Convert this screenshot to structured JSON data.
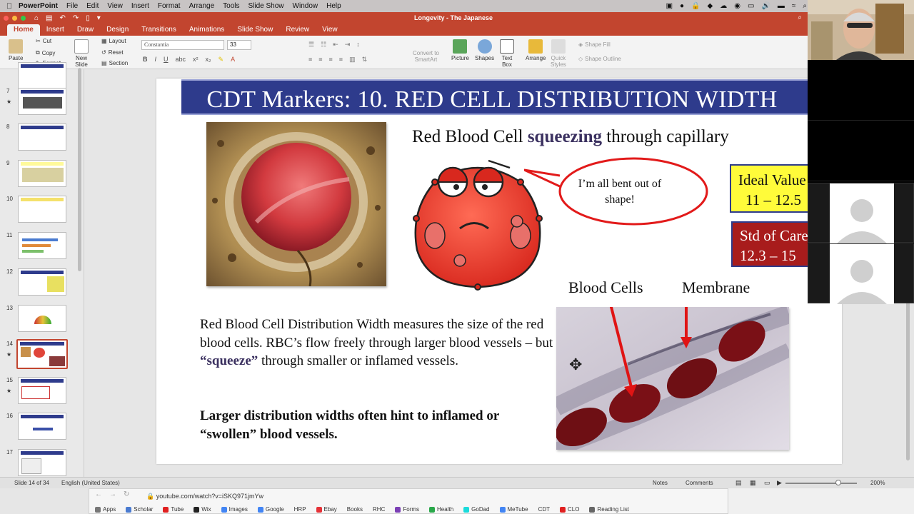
{
  "menubar": {
    "app": "PowerPoint",
    "items": [
      "File",
      "Edit",
      "View",
      "Insert",
      "Format",
      "Arrange",
      "Tools",
      "Slide Show",
      "Window",
      "Help"
    ]
  },
  "titlebar": {
    "doc_title": "Longevity - The Japanese"
  },
  "ribbon_tabs": [
    "Home",
    "Insert",
    "Draw",
    "Design",
    "Transitions",
    "Animations",
    "Slide Show",
    "Review",
    "View"
  ],
  "ribbon": {
    "paste": "Paste",
    "cut": "Cut",
    "copy": "Copy",
    "format": "Format",
    "new_slide": "New\nSlide",
    "layout": "Layout",
    "reset": "Reset",
    "section": "Section",
    "font_name": "Constantia",
    "font_size": "33",
    "convert": "Convert to\nSmartArt",
    "picture": "Picture",
    "shapes": "Shapes",
    "textbox": "Text\nBox",
    "arrange": "Arrange",
    "quick_styles": "Quick\nStyles",
    "shape_fill": "Shape Fill",
    "shape_outline": "Shape Outline"
  },
  "thumbnails": [
    {
      "num": "7",
      "star": "★"
    },
    {
      "num": "8",
      "star": ""
    },
    {
      "num": "9",
      "star": ""
    },
    {
      "num": "10",
      "star": ""
    },
    {
      "num": "11",
      "star": ""
    },
    {
      "num": "12",
      "star": ""
    },
    {
      "num": "13",
      "star": ""
    },
    {
      "num": "14",
      "star": "★"
    },
    {
      "num": "15",
      "star": "★"
    },
    {
      "num": "16",
      "star": ""
    },
    {
      "num": "17",
      "star": ""
    }
  ],
  "slide": {
    "title": "CDT Markers: 10. RED CELL DISTRIBUTION WIDTH",
    "heading_pre": "Red Blood Cell ",
    "heading_strong": "squeezing",
    "heading_post": " through capillary",
    "bubble": "I’m all bent out of shape!",
    "ideal_line1": "Ideal Value",
    "ideal_line2": "11 – 12.5",
    "std_line1": "Std of Care",
    "std_line2": "12.3 – 15",
    "label_cells": "Blood Cells",
    "label_membrane": "Membrane",
    "body_pre": "Red Blood Cell Distribution Width measures the size of the red blood cells. RBC’s flow freely through larger blood vessels – but ",
    "body_em": "“squeeze”",
    "body_post": " through smaller or inflamed vessels.",
    "body_bold": "Larger distribution widths often hint to inflamed or “swollen” blood vessels."
  },
  "statusbar": {
    "slide_of": "Slide 14 of 34",
    "language": "English (United States)",
    "notes": "Notes",
    "comments": "Comments",
    "zoom": "200%"
  },
  "browser": {
    "url": "youtube.com/watch?v=iSKQ971jmYw",
    "bookmarks": [
      "Apps",
      "Scholar",
      "Tube",
      "Wix",
      "Images",
      "Google",
      "HRP",
      "Ebay",
      "Books",
      "RHC",
      "Forms",
      "Health",
      "GoDad",
      "MeTube",
      "CDT",
      "CLO",
      "Reading List"
    ]
  },
  "colors": {
    "accent": "#c2452f",
    "title_bar": "#2e3b8c",
    "ideal_bg": "#fffb3a",
    "std_bg": "#a81c1c"
  }
}
